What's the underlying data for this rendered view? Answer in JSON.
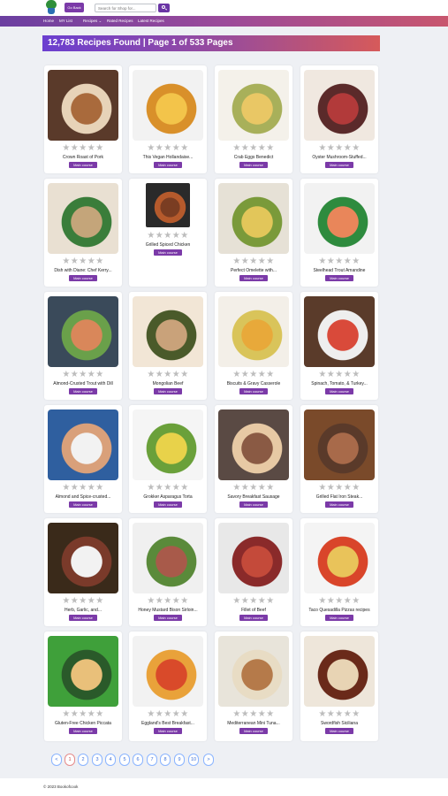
{
  "header": {
    "back_label": "Go Back",
    "search_placeholder": "Search for Shop for..."
  },
  "nav": {
    "items": [
      "Home",
      "MY List",
      "Recipes ⌄",
      "Rated Recipes",
      "Latest Recipes"
    ]
  },
  "hero": {
    "text": "12,783 Recipes Found | Page 1 of 533 Pages"
  },
  "badge_label": "Main course",
  "recipes": [
    {
      "title": "Crown Roast of Pork",
      "rating": 0
    },
    {
      "title": "This Vegan Hollandaise...",
      "rating": 0
    },
    {
      "title": "Crab Eggs Benedict",
      "rating": 0
    },
    {
      "title": "Oyster Mushroom-Stuffed...",
      "rating": 0
    },
    {
      "title": "Dish with Diane: Chef Kerry...",
      "rating": 0
    },
    {
      "title": "Grilled Spiced Chicken",
      "rating": 0
    },
    {
      "title": "Perfect Omelette with...",
      "rating": 0
    },
    {
      "title": "Steelhead Trout Amandine",
      "rating": 0
    },
    {
      "title": "Almond-Crusted Trout with Dill",
      "rating": 0
    },
    {
      "title": "Mongolian Beef",
      "rating": 0
    },
    {
      "title": "Biscuits & Gravy Casserole",
      "rating": 0
    },
    {
      "title": "Spinach, Tomato, & Turkey...",
      "rating": 0
    },
    {
      "title": "Almond and Spice-crusted...",
      "rating": 0
    },
    {
      "title": "Grokker Asparagus Torta",
      "rating": 0
    },
    {
      "title": "Savory Breakfast Sausage",
      "rating": 0
    },
    {
      "title": "Grilled Flat Iron Steak...",
      "rating": 0
    },
    {
      "title": "Herb, Garlic, and...",
      "rating": 0
    },
    {
      "title": "Honey Mustard Bison Sirloin...",
      "rating": 0
    },
    {
      "title": "Fillet of Beef",
      "rating": 0
    },
    {
      "title": "Taco Quesadilla Pizzas recipes",
      "rating": 0
    },
    {
      "title": "Gluten-Free Chicken Piccata",
      "rating": 0
    },
    {
      "title": "Eggland's Best Breakfast...",
      "rating": 0
    },
    {
      "title": "Mediterranean Mini Tuna...",
      "rating": 0
    },
    {
      "title": "Swordfish Siciliana",
      "rating": 0
    }
  ],
  "pagination": [
    "<",
    "1",
    "2",
    "3",
    "4",
    "5",
    "6",
    "7",
    "8",
    "9",
    "10",
    ">"
  ],
  "pagination_active": "1",
  "footer": {
    "text": "© 2023 Bookofcook"
  }
}
